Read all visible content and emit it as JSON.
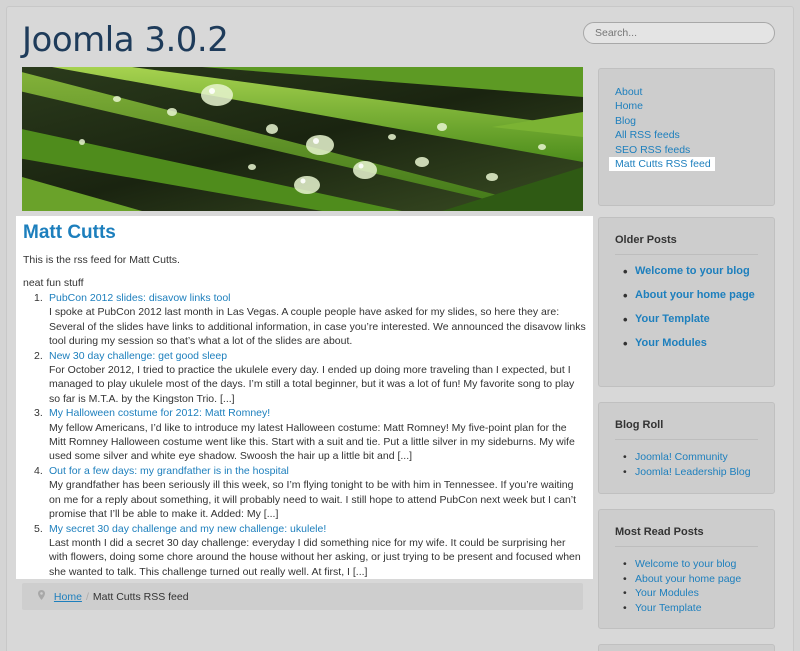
{
  "site": {
    "title": "Joomla 3.0.2"
  },
  "search": {
    "placeholder": "Search..."
  },
  "article": {
    "title": "Matt Cutts",
    "description": "This is the rss feed for Matt Cutts.",
    "subtitle": "neat fun stuff",
    "items": [
      {
        "num": "1.",
        "title": "PubCon 2012 slides: disavow links tool",
        "body": "I spoke at PubCon 2012 last month in Las Vegas. A couple people have asked for my slides, so here they are: Several of the slides have links to additional information, in case you’re interested. We announced the disavow links tool during my session so that’s what a lot of the slides are about."
      },
      {
        "num": "2.",
        "title": "New 30 day challenge: get good sleep",
        "body": "For October 2012, I tried to practice the ukulele every day. I ended up doing more traveling than I expected, but I managed to play ukulele most of the days. I’m still a total beginner, but it was a lot of fun! My favorite song to play so far is M.T.A. by the Kingston Trio. [...]"
      },
      {
        "num": "3.",
        "title": "My Halloween costume for 2012: Matt Romney!",
        "body": "My fellow Americans, I’d like to introduce my latest Halloween costume: Matt Romney! My five-point plan for the Mitt Romney Halloween costume went like this. Start with a suit and tie. Put a little silver in my sideburns. My wife used some silver and white eye shadow. Swoosh the hair up a little bit and [...]"
      },
      {
        "num": "4.",
        "title": "Out for a few days: my grandfather is in the hospital",
        "body": "My grandfather has been seriously ill this week, so I’m flying tonight to be with him in Tennessee. If you’re waiting on me for a reply about something, it will probably need to wait. I still hope to attend PubCon next week but I can’t promise that I’ll be able to make it. Added: My [...]"
      },
      {
        "num": "5.",
        "title": "My secret 30 day challenge and my new challenge: ukulele!",
        "body": "Last month I did a secret 30 day challenge: everyday I did something nice for my wife. It could be surprising her with flowers, doing some chore around the house without her asking, or just trying to be present and focused when she wanted to talk. This challenge turned out really well. At first, I [...]"
      }
    ]
  },
  "breadcrumbs": {
    "home": "Home",
    "separator": "/",
    "current": "Matt Cutts RSS feed"
  },
  "sidebar": {
    "menu": [
      "About",
      "Home",
      "Blog",
      "All RSS feeds",
      "SEO RSS feeds",
      "Matt Cutts RSS feed"
    ],
    "older_posts": {
      "title": "Older Posts",
      "items": [
        "Welcome to your blog",
        "About your home page",
        "Your Template",
        "Your Modules"
      ]
    },
    "blog_roll": {
      "title": "Blog Roll",
      "items": [
        "Joomla! Community",
        "Joomla! Leadership Blog"
      ]
    },
    "most_read": {
      "title": "Most Read Posts",
      "items": [
        "Welcome to your blog",
        "About your home page",
        "Your Modules",
        "Your Template"
      ]
    }
  },
  "colors": {
    "link": "#1d7fbd",
    "title": "#1e3b5a",
    "background": "#d4d4d4"
  },
  "icons": {
    "breadcrumb": "map-pin-icon"
  }
}
